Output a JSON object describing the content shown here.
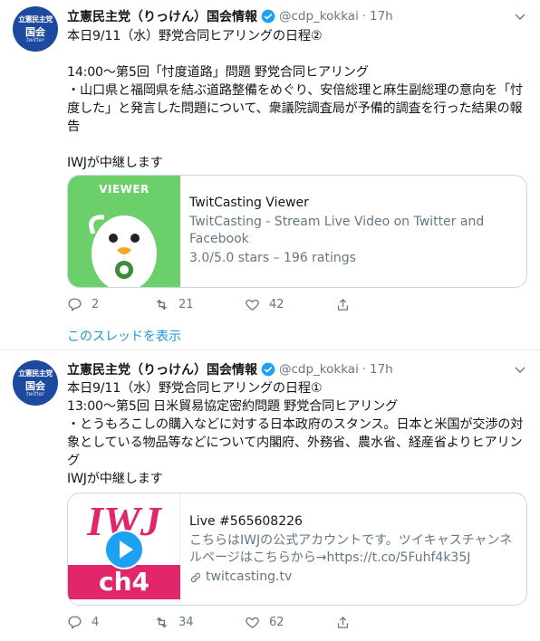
{
  "tweets": [
    {
      "author": {
        "name": "立憲民主党（りっけん）国会情報",
        "handle": "@cdp_kokkai",
        "avatar_text_top": "立憲民主党",
        "avatar_text_mid": "国会",
        "avatar_text_bot": "twitter"
      },
      "dot": "·",
      "time": "17h",
      "text": "本日9/11（水）野党合同ヒアリングの日程②\n\n14:00〜第5回「忖度道路」問題 野党合同ヒアリング\n・山口県と福岡県を結ぶ道路整備をめぐり、安倍総理と麻生副総理の意向を「忖度した」と発言した問題について、衆議院調査局が予備的調査を行った結果の報告\n\nIWJが中継します",
      "card": {
        "image_label": "VIEWER",
        "title": "TwitCasting Viewer",
        "description": "TwitCasting - Stream Live Video on Twitter and Facebook",
        "meta": "3.0/5.0 stars – 196 ratings"
      },
      "actions": {
        "replies": "2",
        "retweets": "21",
        "likes": "42"
      },
      "thread_link": "このスレッドを表示"
    },
    {
      "author": {
        "name": "立憲民主党（りっけん）国会情報",
        "handle": "@cdp_kokkai",
        "avatar_text_top": "立憲民主党",
        "avatar_text_mid": "国会",
        "avatar_text_bot": "twitter"
      },
      "dot": "·",
      "time": "17h",
      "text": "本日9/11（水）野党合同ヒアリングの日程①\n13:00〜第5回 日米貿易協定密約問題 野党合同ヒアリング\n・とうもろこしの購入などに対する日本政府のスタンス。日本と米国が交渉の対象としている物品等などについて内閣府、外務省、農水省、経産省よりヒアリング\nIWJが中継します",
      "card": {
        "image_text_top": "IWJ",
        "image_text_bottom": "ch4",
        "title": "Live #565608226",
        "description": "こちらはIWJの公式アカウントです。ツイキャスチャンネルページはこちらから→https://t.co/5Fuhf4k35J",
        "domain": "twitcasting.tv"
      },
      "actions": {
        "replies": "4",
        "retweets": "34",
        "likes": "62"
      }
    }
  ],
  "colors": {
    "accent": "#1da1f2",
    "link": "#1b95e0",
    "muted": "#657786",
    "twitcasting_green": "#6cd06a",
    "iwj_pink": "#e2266b"
  }
}
